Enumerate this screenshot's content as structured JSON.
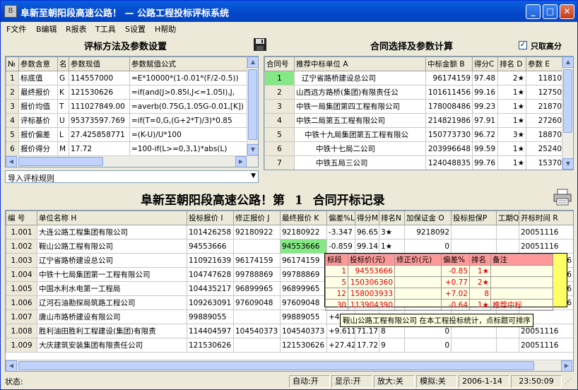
{
  "window": {
    "title": "阜新至朝阳段高速公路！ — 公路工程投标评标系统",
    "icon_text": "B"
  },
  "menu": [
    {
      "label": "F文件"
    },
    {
      "label": "B编辑"
    },
    {
      "label": "R报表"
    },
    {
      "label": "T工具"
    },
    {
      "label": "S设置"
    },
    {
      "label": "H帮助"
    }
  ],
  "left_panel": {
    "title": "评标方法及参数设置",
    "headers": [
      "№",
      "参数含意",
      "名",
      "参数现值",
      "参数赋值公式"
    ],
    "rows": [
      [
        "1",
        "标底值",
        "G",
        "114557000",
        "=E*10000*(1-0.01*(F/2-0.5))"
      ],
      [
        "2",
        "最终报价",
        "K",
        "121530626",
        "=if(and(J>0.85I,J<=1.05I),J,"
      ],
      [
        "3",
        "报价均值",
        "T",
        "111027849.00",
        "=averb(0.75G,1.05G-0.01,[K])"
      ],
      [
        "4",
        "评标基价",
        "U",
        "95373597.769",
        "=if(T=0,G,(G+2*T)/3)*0.85"
      ],
      [
        "5",
        "报价偏差",
        "L",
        "27.425858771",
        "=(K-U)/U*100"
      ],
      [
        "6",
        "报价得分",
        "M",
        "17.72",
        "=100-if(L>=0,3,1)*abs(L)"
      ]
    ],
    "combo_value": "导入评标规则"
  },
  "right_panel": {
    "title": "合同选择及参数计算",
    "checkbox_label": "只取高分",
    "checkbox_mark": "✓",
    "headers": [
      "合同号",
      "推荐中标单位 A",
      "中标金额 B",
      "得分C",
      "排名 D",
      "参数 E"
    ],
    "rows": [
      [
        "1",
        "辽宁省路桥建设总公司",
        "96174159",
        "97.48",
        "2★",
        "11810"
      ],
      [
        "2",
        "山西远方路桥(集团)有限责任公",
        "101611456",
        "99.16",
        "1★",
        "12750"
      ],
      [
        "3",
        "中铁一局集团第四工程有限公司",
        "178008486",
        "99.23",
        "1★",
        "21870"
      ],
      [
        "4",
        "中铁二局第五工程有限公司",
        "214821986",
        "97.91",
        "1★",
        "27260"
      ],
      [
        "5",
        "中铁十九局集团第五工程有限公",
        "150773730",
        "96.72",
        "3★",
        "18870"
      ],
      [
        "6",
        "中铁十七局二公司",
        "203996648",
        "99.59",
        "1★",
        "25240"
      ],
      [
        "7",
        "中铁五局三公司",
        "124048835",
        "99.76",
        "1★",
        "15370"
      ]
    ]
  },
  "main": {
    "title_prefix": "阜新至朝阳段高速公路！第",
    "contract_no": "1",
    "title_suffix": "合同开标记录",
    "headers": [
      "编 号",
      "单位名称 H",
      "投标报价 I",
      "修正报价 J",
      "最终报价 K",
      "偏差%L",
      "得分M",
      "排名N",
      "加保证金 O",
      "投标担保P",
      "工期Q",
      "开标时间 R"
    ],
    "rows": [
      [
        "1.001",
        "大连公路工程集团有限公司",
        "101426258",
        "92180922",
        "92180922",
        "-3.347",
        "96.65",
        "3★",
        "9218092",
        "",
        "",
        "20051116"
      ],
      [
        "1.002",
        "鞍山公路工程有限公司",
        "94553666",
        "",
        "94553666",
        "-0.859",
        "99.14",
        "1★",
        "0",
        "",
        "",
        "20051116"
      ],
      [
        "1.003",
        "辽宁省路桥建设总公司",
        "110921639",
        "96174159",
        "96174159",
        "",
        "",
        "",
        "",
        "",
        "",
        "116"
      ],
      [
        "1.004",
        "中铁十七局集团第一工程有限公司",
        "104747628",
        "99788869",
        "99788869",
        "",
        "",
        "",
        "",
        "",
        "",
        "116"
      ],
      [
        "1.005",
        "中国水利水电第一工程局",
        "104435217",
        "96899965",
        "96899965",
        "",
        "",
        "",
        "",
        "",
        "",
        "116"
      ],
      [
        "1.006",
        "辽河石油勘探局筑路工程公司",
        "109263091",
        "97609048",
        "97609048",
        "",
        "",
        "",
        "",
        "",
        "",
        "116"
      ],
      [
        "1.007",
        "唐山市路桥建设有限公司",
        "99889055",
        "",
        "99889055",
        "+4.",
        "",
        "",
        "",
        "",
        "",
        ""
      ],
      [
        "1.008",
        "胜利油田胜利工程建设(集团)有限责",
        "114404597",
        "104540373",
        "104540373",
        "+9.611",
        "71.17",
        "8",
        "0",
        "",
        "",
        "20051116"
      ],
      [
        "1.009",
        "大庆建筑安装集团有限责任公司",
        "121530626",
        "",
        "121530626",
        "+27.42",
        "17.72",
        "9",
        "0",
        "",
        "",
        "20051116"
      ]
    ]
  },
  "popup": {
    "headers": [
      "标段",
      "投标价(元)",
      "修正价(元)",
      "偏差%",
      "排名",
      "备注"
    ],
    "rows": [
      [
        "1",
        "94553666",
        "",
        "-0.85",
        "1★",
        ""
      ],
      [
        "5",
        "150306360",
        "",
        "+0.77",
        "2★",
        ""
      ],
      [
        "12",
        "158003933",
        "",
        "+7.02",
        "8",
        ""
      ],
      [
        "30",
        "113904390",
        "",
        "-0.64",
        "1★",
        "推荐中标"
      ]
    ]
  },
  "tooltip": "鞍山公路工程有限公司 在本工程投标统计，点标题可排序",
  "status": {
    "label": "状态:",
    "auto": "自动:开",
    "display": "显示:开",
    "zoom": "放大:关",
    "simulate": "模拟:关",
    "date": "2006-1-14",
    "time": "23:50:09"
  }
}
